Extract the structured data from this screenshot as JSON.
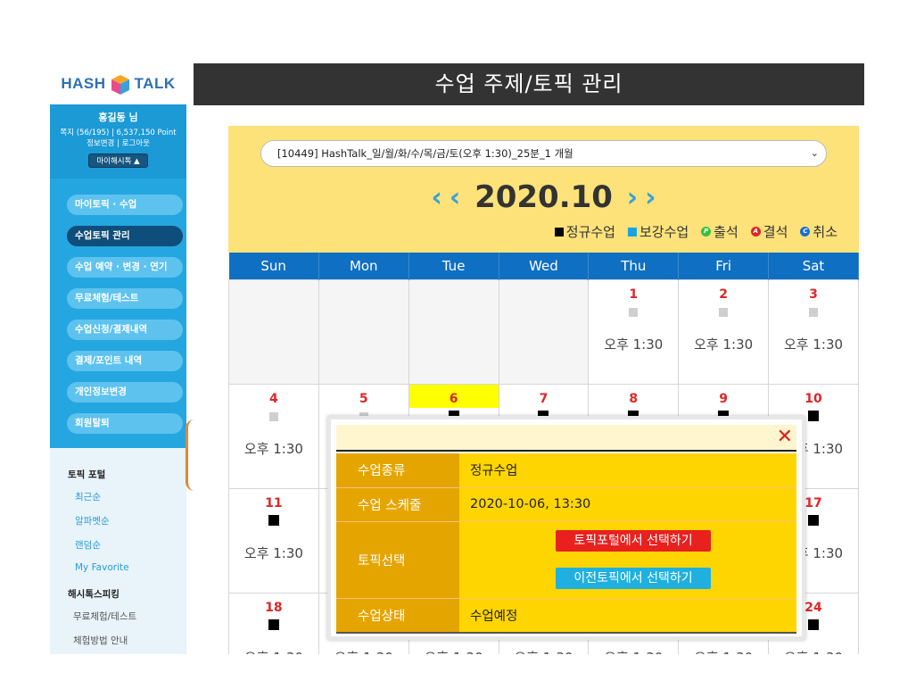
{
  "app": {
    "logo_text_left": "HASH",
    "logo_text_right": "TALK",
    "page_title": "수업 주제/토픽 관리"
  },
  "user": {
    "name": "홍길동 님",
    "stats": "쪽지 (56/195) | 6,537,150 Point",
    "links": "정보변경 | 로그아웃",
    "my_hashtalk": "마이해시톡 ▲"
  },
  "sidebar": {
    "items": [
      {
        "label": "마이토픽 · 수업",
        "active": false
      },
      {
        "label": "수업토픽 관리",
        "active": true
      },
      {
        "label": "수업 예약 · 변경 · 연기",
        "active": false
      },
      {
        "label": "무료체험/테스트",
        "active": false
      },
      {
        "label": "수업신청/결제내역",
        "active": false
      },
      {
        "label": "결제/포인트 내역",
        "active": false
      },
      {
        "label": "개인정보변경",
        "active": false
      },
      {
        "label": "회원탈퇴",
        "active": false
      }
    ],
    "portal_title": "토픽 포털",
    "portal_links": [
      "최근순",
      "알파벳순",
      "랜덤순",
      "My Favorite"
    ],
    "speaking_title": "해시톡스피킹",
    "speaking_links": [
      "무료체험/테스트",
      "체험방법 안내"
    ]
  },
  "calendar": {
    "course_select": "[10449] HashTalk_일/월/화/수/목/금/토(오후 1:30)_25분_1 개월",
    "month": "2020.10",
    "legend": {
      "regular": "정규수업",
      "makeup": "보강수업",
      "attend": "출석",
      "absent": "결석",
      "cancel": "취소"
    },
    "weekdays": [
      "Sun",
      "Mon",
      "Tue",
      "Wed",
      "Thu",
      "Fri",
      "Sat"
    ],
    "time_label": "오후 1:30",
    "week1": [
      "",
      "",
      "",
      "",
      "1",
      "2",
      "3"
    ],
    "week2": [
      "4",
      "5",
      "6",
      "7",
      "8",
      "9",
      "10"
    ],
    "week3": [
      "11",
      "",
      "",
      "",
      "",
      "",
      "17"
    ],
    "week4": [
      "18",
      "",
      "",
      "",
      "",
      "",
      "24"
    ],
    "colors": {
      "header": "#0f6fc2",
      "panel": "#fde27a",
      "today": "#ffff00",
      "date": "#e02525"
    }
  },
  "popup": {
    "rows": {
      "type_label": "수업종류",
      "type_value": "정규수업",
      "schedule_label": "수업 스케줄",
      "schedule_value": "2020-10-06, 13:30",
      "topic_label": "토픽선택",
      "topic_portal_btn": "토픽포털에서 선택하기",
      "topic_prev_btn": "이전토픽에서 선택하기",
      "status_label": "수업상태",
      "status_value": "수업예정"
    },
    "close_icon": "✕"
  }
}
